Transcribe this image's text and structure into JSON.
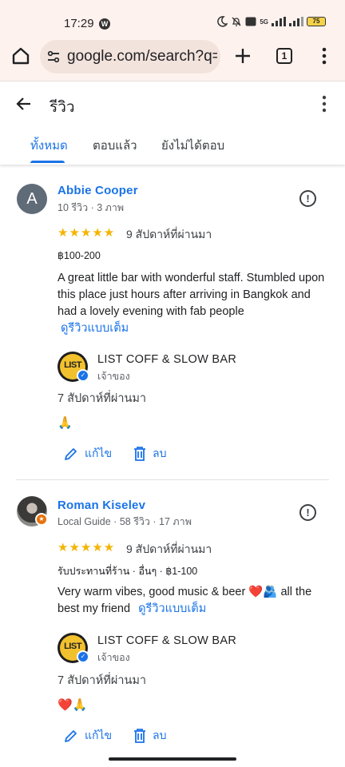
{
  "status_bar": {
    "time": "17:29",
    "app_badge": "W",
    "network": "5G",
    "battery": "75"
  },
  "browser": {
    "url": "google.com/search?q=l",
    "tab_count": "1"
  },
  "header": {
    "title": "รีวิว",
    "tabs": [
      {
        "label": "ทั้งหมด",
        "active": true
      },
      {
        "label": "ตอบแล้ว",
        "active": false
      },
      {
        "label": "ยังไม่ได้ตอบ",
        "active": false
      }
    ]
  },
  "reviews": [
    {
      "avatar_letter": "A",
      "name": "Abbie Cooper",
      "meta": "10 รีวิว · 3 ภาพ",
      "stars": "★★★★★",
      "rating": 5,
      "date": "9 สัปดาห์ที่ผ่านมา",
      "tags": "฿100-200",
      "text": "A great little bar with wonderful staff. Stumbled upon this place just hours after arriving in Bangkok and had a lovely evening with fab people",
      "more_link": "ดูรีวิวแบบเต็ม",
      "owner_name": "LIST COFF & SLOW BAR",
      "owner_role": "เจ้าของ",
      "owner_logo_text": "LIST",
      "owner_date": "7 สัปดาห์ที่ผ่านมา",
      "owner_reply": "🙏",
      "edit_label": "แก้ไข",
      "delete_label": "ลบ"
    },
    {
      "name": "Roman Kiselev",
      "meta": "Local Guide · 58 รีวิว · 17 ภาพ",
      "stars": "★★★★★",
      "rating": 5,
      "date": "9 สัปดาห์ที่ผ่านมา",
      "tags": "รับประทานที่ร้าน  ·  อื่นๆ  ·  ฿1-100",
      "text_main": "Very warm vibes, good music & beer ❤️🫂 all the best my friend",
      "more_link": "ดูรีวิวแบบเต็ม",
      "owner_name": "LIST COFF & SLOW BAR",
      "owner_role": "เจ้าของ",
      "owner_logo_text": "LIST",
      "owner_date": "7 สัปดาห์ที่ผ่านมา",
      "owner_reply": "❤️🙏",
      "edit_label": "แก้ไข",
      "delete_label": "ลบ"
    }
  ],
  "icons": {
    "back": "arrow-left-icon",
    "more": "more-vert-icon",
    "flag": "report-icon",
    "edit": "pencil-icon",
    "delete": "trash-icon",
    "verified": "check-badge-icon"
  },
  "colors": {
    "accent": "#1a73e8",
    "star": "#f4b400",
    "chrome_bg": "#fdf2ee"
  }
}
